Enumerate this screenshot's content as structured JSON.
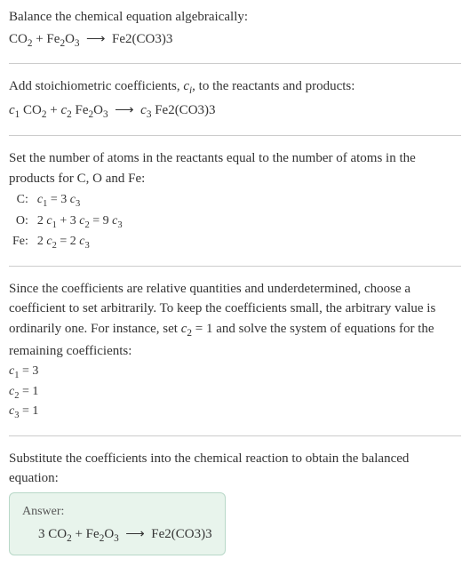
{
  "section1": {
    "text": "Balance the chemical equation algebraically:",
    "equation_html": "CO<sub>2</sub> + Fe<sub>2</sub>O<sub>3</sub>&nbsp; ⟶ &nbsp;Fe2(CO3)3"
  },
  "section2": {
    "text_html": "Add stoichiometric coefficients, <span class=\"italic\">c<sub>i</sub></span>, to the reactants and products:",
    "equation_html": "<span class=\"italic\">c</span><sub>1</sub> CO<sub>2</sub> + <span class=\"italic\">c</span><sub>2</sub> Fe<sub>2</sub>O<sub>3</sub>&nbsp; ⟶ &nbsp;<span class=\"italic\">c</span><sub>3</sub> Fe2(CO3)3"
  },
  "section3": {
    "text": "Set the number of atoms in the reactants equal to the number of atoms in the products for C, O and Fe:",
    "rows": [
      {
        "label": "C:",
        "eq_html": "<span class=\"italic\">c</span><sub>1</sub> = 3 <span class=\"italic\">c</span><sub>3</sub>"
      },
      {
        "label": "O:",
        "eq_html": "2 <span class=\"italic\">c</span><sub>1</sub> + 3 <span class=\"italic\">c</span><sub>2</sub> = 9 <span class=\"italic\">c</span><sub>3</sub>"
      },
      {
        "label": "Fe:",
        "eq_html": "2 <span class=\"italic\">c</span><sub>2</sub> = 2 <span class=\"italic\">c</span><sub>3</sub>"
      }
    ]
  },
  "section4": {
    "text_html": "Since the coefficients are relative quantities and underdetermined, choose a coefficient to set arbitrarily. To keep the coefficients small, the arbitrary value is ordinarily one. For instance, set <span class=\"italic\">c</span><sub>2</sub> = 1 and solve the system of equations for the remaining coefficients:",
    "coeffs": [
      "<span class=\"italic\">c</span><sub>1</sub> = 3",
      "<span class=\"italic\">c</span><sub>2</sub> = 1",
      "<span class=\"italic\">c</span><sub>3</sub> = 1"
    ]
  },
  "section5": {
    "text": "Substitute the coefficients into the chemical reaction to obtain the balanced equation:"
  },
  "answer": {
    "label": "Answer:",
    "equation_html": "3 CO<sub>2</sub> + Fe<sub>2</sub>O<sub>3</sub>&nbsp; ⟶ &nbsp;Fe2(CO3)3"
  }
}
